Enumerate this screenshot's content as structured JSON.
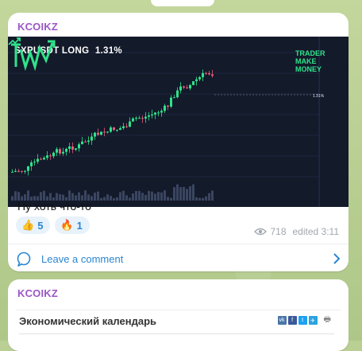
{
  "post": {
    "channel": "KCOIKZ",
    "chart_image": {
      "pair": "SXPUSDT",
      "side": "LONG",
      "change": "1.31%",
      "brand_line1": "TRADER",
      "brand_line2": "MAKE",
      "brand_line3": "MONEY",
      "price_tag": "1.31%"
    },
    "text": "Ну хоть что-то",
    "reactions": [
      {
        "icon": "thumbs-up-icon",
        "emoji": "👍",
        "count": "5"
      },
      {
        "icon": "fire-icon",
        "emoji": "🔥",
        "count": "1"
      }
    ],
    "views": "718",
    "edited": "edited 3:11",
    "comment_label": "Leave a comment"
  },
  "post2": {
    "channel": "KCOIKZ",
    "widget_title": "Экономический календарь",
    "share": [
      {
        "icon": "vk-icon",
        "glyph": "vk",
        "color": "#4a76a8"
      },
      {
        "icon": "facebook-icon",
        "glyph": "f",
        "color": "#3b5998"
      },
      {
        "icon": "twitter-icon",
        "glyph": "t",
        "color": "#1da1f2"
      },
      {
        "icon": "telegram-icon",
        "glyph": "✈",
        "color": "#2aa3df"
      }
    ]
  },
  "colors": {
    "channel": "#9a57c6",
    "link": "#2a86d1",
    "chart_bg": "#131a2a",
    "candle_up": "#2ee38a",
    "candle_down": "#e85a7a"
  }
}
